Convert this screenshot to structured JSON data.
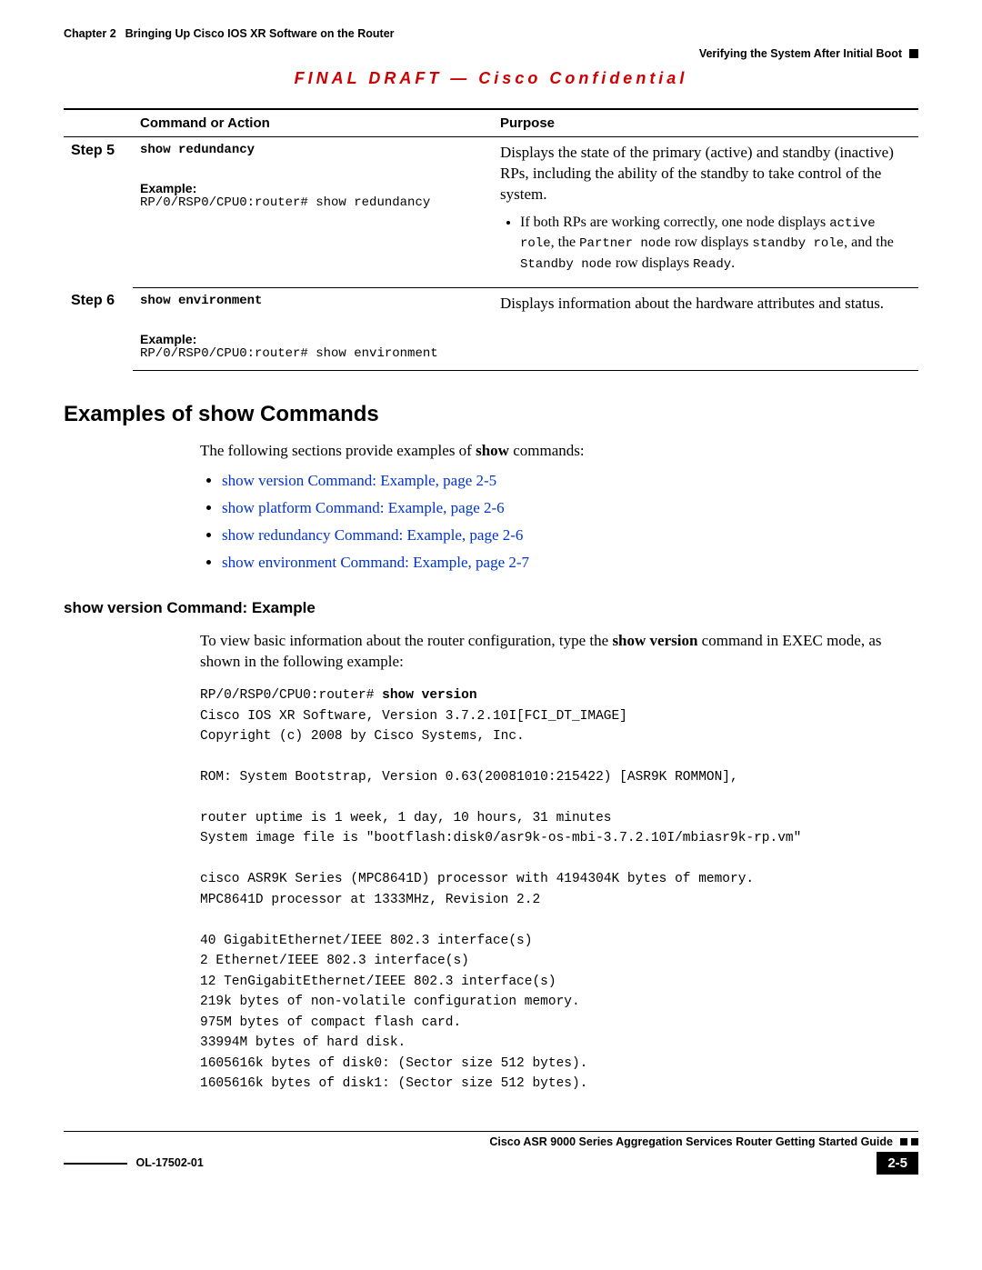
{
  "header": {
    "chapter_label": "Chapter 2",
    "chapter_title": "Bringing Up Cisco IOS XR Software on the Router",
    "section_right": "Verifying the System After Initial Boot"
  },
  "final_draft": "FINAL DRAFT — Cisco Confidential",
  "table": {
    "headers": {
      "step": "",
      "command": "Command or Action",
      "purpose": "Purpose"
    },
    "step5": {
      "step": "Step 5",
      "command": "show redundancy",
      "example_label": "Example:",
      "example_cmd": "RP/0/RSP0/CPU0:router# show redundancy",
      "purpose_main": "Displays the state of the primary (active) and standby (inactive) RPs, including the ability of the standby to take control of the system.",
      "bullet_pre": "If both RPs are working correctly, one node displays ",
      "bullet_code1": "active role",
      "bullet_mid1": ", the ",
      "bullet_code2": "Partner node",
      "bullet_mid2": " row displays ",
      "bullet_code3": "standby role",
      "bullet_mid3": ", and the ",
      "bullet_code4": "Standby node",
      "bullet_mid4": " row displays ",
      "bullet_code5": "Ready",
      "bullet_end": "."
    },
    "step6": {
      "step": "Step 6",
      "command": "show environment",
      "example_label": "Example:",
      "example_cmd": "RP/0/RSP0/CPU0:router# show environment",
      "purpose_main": "Displays information about the hardware attributes and status."
    }
  },
  "examples_heading": "Examples of show Commands",
  "intro_pre": "The following sections provide examples of ",
  "intro_bold": "show",
  "intro_post": " commands:",
  "links": [
    "show version Command: Example, page 2-5",
    "show platform Command: Example, page 2-6",
    "show redundancy Command: Example, page 2-6",
    "show environment Command: Example, page 2-7"
  ],
  "sub_heading": "show version Command: Example",
  "sub_body_pre": "To view basic information about the router configuration, type the ",
  "sub_body_bold": "show version",
  "sub_body_post": " command in EXEC mode, as shown in the following example:",
  "console_prompt": "RP/0/RSP0/CPU0:router# ",
  "console_cmd": "show version",
  "console_output": "\nCisco IOS XR Software, Version 3.7.2.10I[FCI_DT_IMAGE]\nCopyright (c) 2008 by Cisco Systems, Inc.\n\nROM: System Bootstrap, Version 0.63(20081010:215422) [ASR9K ROMMON],\n\nrouter uptime is 1 week, 1 day, 10 hours, 31 minutes\nSystem image file is \"bootflash:disk0/asr9k-os-mbi-3.7.2.10I/mbiasr9k-rp.vm\"\n\ncisco ASR9K Series (MPC8641D) processor with 4194304K bytes of memory.\nMPC8641D processor at 1333MHz, Revision 2.2\n\n40 GigabitEthernet/IEEE 802.3 interface(s)\n2 Ethernet/IEEE 802.3 interface(s)\n12 TenGigabitEthernet/IEEE 802.3 interface(s)\n219k bytes of non-volatile configuration memory.\n975M bytes of compact flash card.\n33994M bytes of hard disk.\n1605616k bytes of disk0: (Sector size 512 bytes).\n1605616k bytes of disk1: (Sector size 512 bytes).",
  "footer": {
    "guide": "Cisco ASR 9000 Series Aggregation Services Router Getting Started Guide",
    "doc_id": "OL-17502-01",
    "page": "2-5"
  }
}
